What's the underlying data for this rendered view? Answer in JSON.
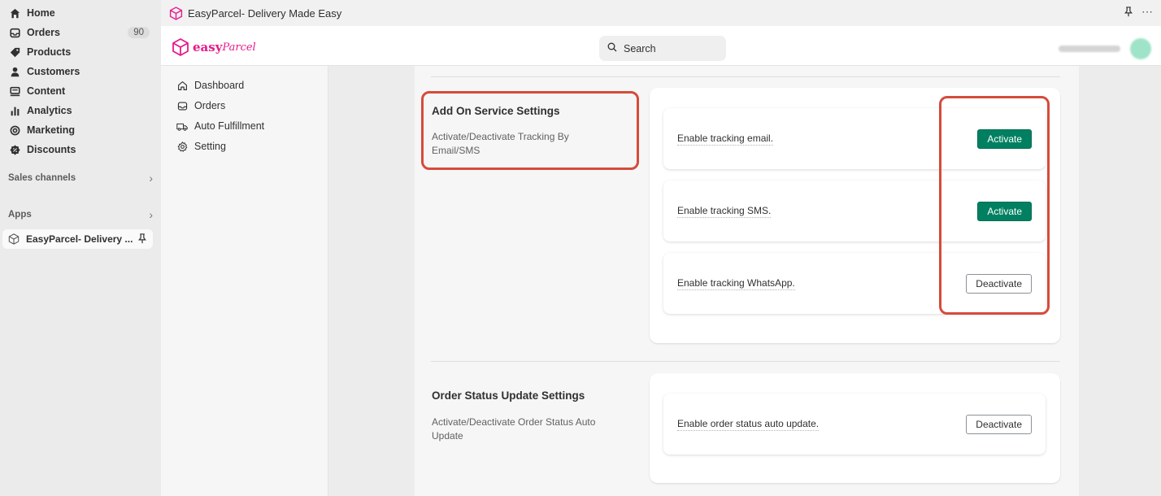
{
  "admin_nav": {
    "items": [
      {
        "label": "Home",
        "icon": "home-icon"
      },
      {
        "label": "Orders",
        "icon": "orders-icon",
        "count": "90"
      },
      {
        "label": "Products",
        "icon": "tag-icon"
      },
      {
        "label": "Customers",
        "icon": "person-icon"
      },
      {
        "label": "Content",
        "icon": "content-icon"
      },
      {
        "label": "Analytics",
        "icon": "bar-chart-icon"
      },
      {
        "label": "Marketing",
        "icon": "target-icon"
      },
      {
        "label": "Discounts",
        "icon": "discount-icon"
      }
    ],
    "sales_channels": "Sales channels",
    "apps": "Apps",
    "app_item": "EasyParcel- Delivery ..."
  },
  "app_bar": {
    "title": "EasyParcel- Delivery Made Easy",
    "more": "⋯"
  },
  "header": {
    "logo_word": "easy",
    "logo_word2": "Parcel",
    "search_placeholder": "Search"
  },
  "app_sidebar": {
    "items": [
      {
        "label": "Dashboard",
        "icon": "home-icon"
      },
      {
        "label": "Orders",
        "icon": "inbox-icon"
      },
      {
        "label": "Auto Fulfillment",
        "icon": "truck-icon"
      },
      {
        "label": "Setting",
        "icon": "gear-icon"
      }
    ]
  },
  "sections": [
    {
      "title": "Add On Service Settings",
      "description": "Activate/Deactivate Tracking By Email/SMS",
      "rows": [
        {
          "label": "Enable tracking email.",
          "button": "Activate",
          "style": "primary"
        },
        {
          "label": "Enable tracking SMS.",
          "button": "Activate",
          "style": "primary"
        },
        {
          "label": "Enable tracking WhatsApp.",
          "button": "Deactivate",
          "style": "secondary"
        }
      ]
    },
    {
      "title": "Order Status Update Settings",
      "description": "Activate/Deactivate Order Status Auto Update",
      "rows": [
        {
          "label": "Enable order status auto update.",
          "button": "Deactivate",
          "style": "secondary"
        }
      ]
    }
  ],
  "colors": {
    "primary_button": "#008060",
    "highlight": "#d64b3b",
    "brand": "#e7198a"
  }
}
